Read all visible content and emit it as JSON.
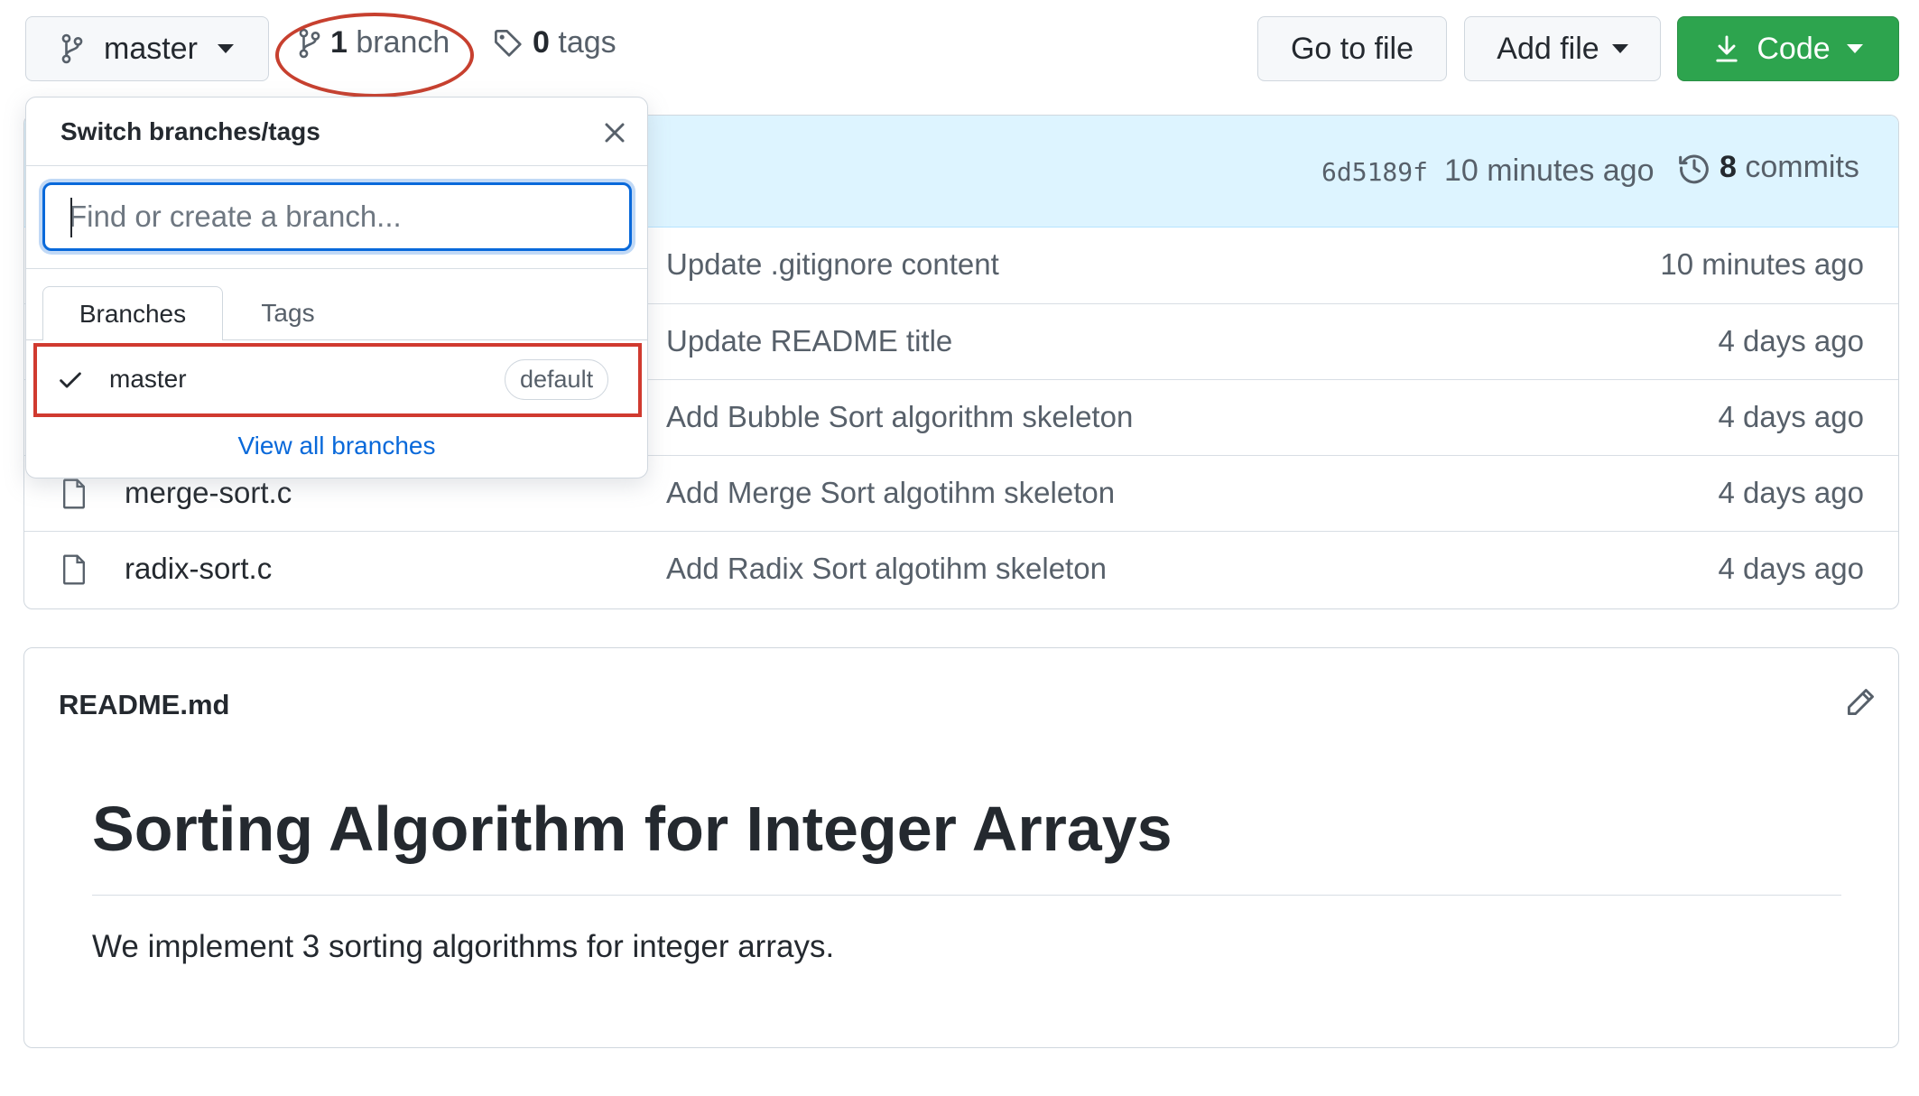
{
  "toolbar": {
    "branch_button_label": "master",
    "branches": {
      "count": "1",
      "label": "branch"
    },
    "tags": {
      "count": "0",
      "label": "tags"
    },
    "go_to_file_label": "Go to file",
    "add_file_label": "Add file",
    "code_label": "Code"
  },
  "latest_commit": {
    "sha": "6d5189f",
    "time": "10 minutes ago",
    "commits_count": "8",
    "commits_label": "commits"
  },
  "files": [
    {
      "name": "",
      "message": "Update .gitignore content",
      "age": "10 minutes ago"
    },
    {
      "name": "",
      "message": "Update README title",
      "age": "4 days ago"
    },
    {
      "name": "",
      "message": "Add Bubble Sort algorithm skeleton",
      "age": "4 days ago"
    },
    {
      "name": "merge-sort.c",
      "message": "Add Merge Sort algotihm skeleton",
      "age": "4 days ago"
    },
    {
      "name": "radix-sort.c",
      "message": "Add Radix Sort algotihm skeleton",
      "age": "4 days ago"
    }
  ],
  "branch_dropdown": {
    "title": "Switch branches/tags",
    "search_placeholder": "Find or create a branch...",
    "tabs": [
      "Branches",
      "Tags"
    ],
    "branch_name": "master",
    "badge": "default",
    "view_all_label": "View all branches"
  },
  "readme": {
    "filename": "README.md",
    "heading": "Sorting Algorithm for Integer Arrays",
    "body": "We implement 3 sorting algorithms for integer arrays."
  },
  "colors": {
    "accent_blue": "#0969da",
    "code_green": "#2da44e",
    "annotation_red": "#c7402f",
    "commit_bar_bg": "#ddf4ff"
  }
}
